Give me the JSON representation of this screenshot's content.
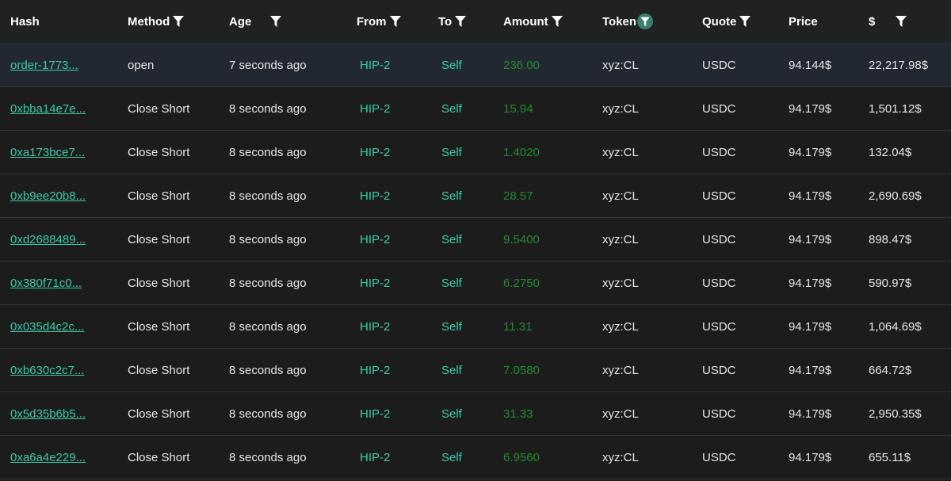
{
  "header": {
    "hash": "Hash",
    "method": "Method",
    "age": "Age",
    "from": "From",
    "to": "To",
    "amount": "Amount",
    "token": "Token",
    "quote": "Quote",
    "price": "Price",
    "usd": "$"
  },
  "rows": [
    {
      "hash": "order-1773...",
      "method": "open",
      "age": "7 seconds ago",
      "from": "HIP-2",
      "to": "Self",
      "amount": "236.00",
      "token": "xyz:CL",
      "quote": "USDC",
      "price": "94.144$",
      "usd": "22,217.98$"
    },
    {
      "hash": "0xbba14e7e...",
      "method": "Close Short",
      "age": "8 seconds ago",
      "from": "HIP-2",
      "to": "Self",
      "amount": "15.94",
      "token": "xyz:CL",
      "quote": "USDC",
      "price": "94.179$",
      "usd": "1,501.12$"
    },
    {
      "hash": "0xa173bce7...",
      "method": "Close Short",
      "age": "8 seconds ago",
      "from": "HIP-2",
      "to": "Self",
      "amount": "1.4020",
      "token": "xyz:CL",
      "quote": "USDC",
      "price": "94.179$",
      "usd": "132.04$"
    },
    {
      "hash": "0xb9ee20b8...",
      "method": "Close Short",
      "age": "8 seconds ago",
      "from": "HIP-2",
      "to": "Self",
      "amount": "28.57",
      "token": "xyz:CL",
      "quote": "USDC",
      "price": "94.179$",
      "usd": "2,690.69$"
    },
    {
      "hash": "0xd2688489...",
      "method": "Close Short",
      "age": "8 seconds ago",
      "from": "HIP-2",
      "to": "Self",
      "amount": "9.5400",
      "token": "xyz:CL",
      "quote": "USDC",
      "price": "94.179$",
      "usd": "898.47$"
    },
    {
      "hash": "0x380f71c0...",
      "method": "Close Short",
      "age": "8 seconds ago",
      "from": "HIP-2",
      "to": "Self",
      "amount": "6.2750",
      "token": "xyz:CL",
      "quote": "USDC",
      "price": "94.179$",
      "usd": "590.97$"
    },
    {
      "hash": "0x035d4c2c...",
      "method": "Close Short",
      "age": "8 seconds ago",
      "from": "HIP-2",
      "to": "Self",
      "amount": "11.31",
      "token": "xyz:CL",
      "quote": "USDC",
      "price": "94.179$",
      "usd": "1,064.69$"
    },
    {
      "hash": "0xb630c2c7...",
      "method": "Close Short",
      "age": "8 seconds ago",
      "from": "HIP-2",
      "to": "Self",
      "amount": "7.0580",
      "token": "xyz:CL",
      "quote": "USDC",
      "price": "94.179$",
      "usd": "664.72$"
    },
    {
      "hash": "0x5d35b6b5...",
      "method": "Close Short",
      "age": "8 seconds ago",
      "from": "HIP-2",
      "to": "Self",
      "amount": "31.33",
      "token": "xyz:CL",
      "quote": "USDC",
      "price": "94.179$",
      "usd": "2,950.35$"
    },
    {
      "hash": "0xa6a4e229...",
      "method": "Close Short",
      "age": "8 seconds ago",
      "from": "HIP-2",
      "to": "Self",
      "amount": "6.9560",
      "token": "xyz:CL",
      "quote": "USDC",
      "price": "94.179$",
      "usd": "655.11$"
    }
  ],
  "filters": {
    "method": "filter-icon",
    "age": "filter-icon",
    "from": "filter-icon",
    "to": "filter-icon",
    "amount": "filter-icon",
    "token": "filter-icon-active",
    "quote": "filter-icon",
    "usd": "filter-icon"
  },
  "colors": {
    "background": "#1c1c1d",
    "header_background": "#202122",
    "first_row_background": "#222832",
    "link": "#3cc9a6",
    "amount": "#1f8d2c",
    "active_filter": "#3d7f6e"
  }
}
